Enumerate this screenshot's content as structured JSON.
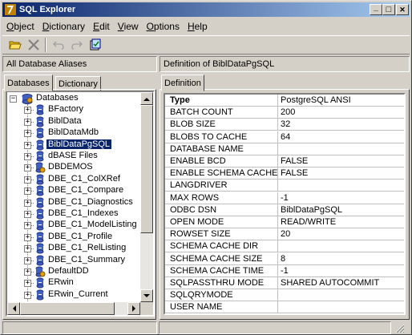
{
  "window": {
    "title": "SQL Explorer",
    "min_glyph": "_",
    "max_glyph": "□",
    "close_glyph": "✕"
  },
  "menu": [
    {
      "label": "Object",
      "underline": "O",
      "rest": "bject"
    },
    {
      "label": "Dictionary",
      "underline": "D",
      "rest": "ictionary"
    },
    {
      "label": "Edit",
      "underline": "E",
      "rest": "dit"
    },
    {
      "label": "View",
      "underline": "V",
      "rest": "iew"
    },
    {
      "label": "Options",
      "underline": "O",
      "rest": "ptions"
    },
    {
      "label": "Help",
      "underline": "H",
      "rest": "elp"
    }
  ],
  "toolbar": {
    "open_icon": "open-folder-icon",
    "delete_icon": "delete-x-icon",
    "undo_icon": "undo-icon",
    "redo_icon": "redo-icon",
    "apply_icon": "apply-icon"
  },
  "left_header": "All Database Aliases",
  "right_header": "Definition of BiblDataPgSQL",
  "left_tabs": [
    "Databases",
    "Dictionary"
  ],
  "right_tabs": [
    "Definition"
  ],
  "tree": {
    "root": "Databases",
    "items": [
      {
        "label": "BFactory",
        "selected": false
      },
      {
        "label": "BiblData",
        "selected": false
      },
      {
        "label": "BiblDataMdb",
        "selected": false
      },
      {
        "label": "BiblDataPgSQL",
        "selected": true
      },
      {
        "label": "dBASE Files",
        "selected": false
      },
      {
        "label": "DBDEMOS",
        "selected": false
      },
      {
        "label": "DBE_C1_ColXRef",
        "selected": false
      },
      {
        "label": "DBE_C1_Compare",
        "selected": false
      },
      {
        "label": "DBE_C1_Diagnostics",
        "selected": false
      },
      {
        "label": "DBE_C1_Indexes",
        "selected": false
      },
      {
        "label": "DBE_C1_ModelListing",
        "selected": false
      },
      {
        "label": "DBE_C1_Profile",
        "selected": false
      },
      {
        "label": "DBE_C1_RelListing",
        "selected": false
      },
      {
        "label": "DBE_C1_Summary",
        "selected": false
      },
      {
        "label": "DefaultDD",
        "selected": false
      },
      {
        "label": "ERwin",
        "selected": false
      },
      {
        "label": "ERwin_Current",
        "selected": false
      }
    ]
  },
  "definition": {
    "columns": [
      "Type",
      "PostgreSQL ANSI"
    ],
    "rows": [
      [
        "BATCH COUNT",
        "200"
      ],
      [
        "BLOB SIZE",
        "32"
      ],
      [
        "BLOBS TO CACHE",
        "64"
      ],
      [
        "DATABASE NAME",
        ""
      ],
      [
        "ENABLE BCD",
        "FALSE"
      ],
      [
        "ENABLE SCHEMA CACHE",
        "FALSE"
      ],
      [
        "LANGDRIVER",
        ""
      ],
      [
        "MAX ROWS",
        "-1"
      ],
      [
        "ODBC DSN",
        "BiblDataPgSQL"
      ],
      [
        "OPEN MODE",
        "READ/WRITE"
      ],
      [
        "ROWSET SIZE",
        "20"
      ],
      [
        "SCHEMA CACHE DIR",
        ""
      ],
      [
        "SCHEMA CACHE SIZE",
        "8"
      ],
      [
        "SCHEMA CACHE TIME",
        "-1"
      ],
      [
        "SQLPASSTHRU MODE",
        "SHARED AUTOCOMMIT"
      ],
      [
        "SQLQRYMODE",
        ""
      ],
      [
        "USER NAME",
        ""
      ]
    ]
  },
  "colors": {
    "title_start": "#0a246a",
    "title_end": "#a6caf0",
    "selection": "#0a246a",
    "face": "#d4d0c8"
  }
}
